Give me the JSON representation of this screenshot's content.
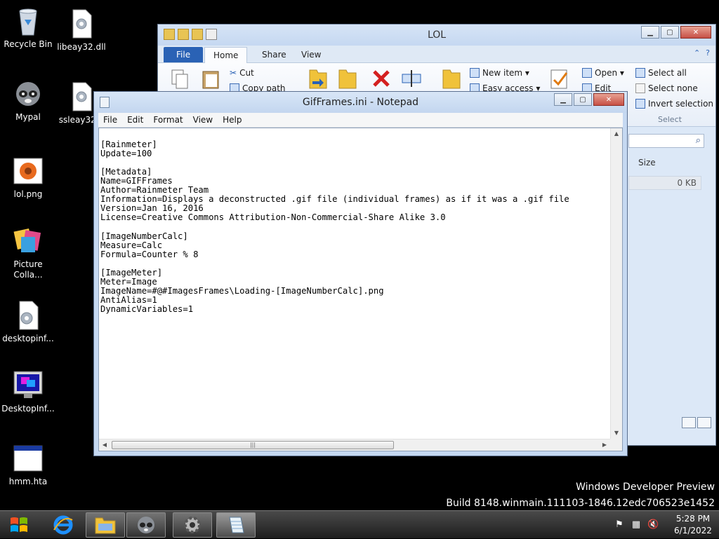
{
  "desktop": {
    "icons": [
      {
        "label": "Recycle Bin"
      },
      {
        "label": "libeay32.dll"
      },
      {
        "label": "Mypal"
      },
      {
        "label": "ssleay32..."
      },
      {
        "label": "lol.png"
      },
      {
        "label": "Picture Colla..."
      },
      {
        "label": "desktopinf..."
      },
      {
        "label": "DesktopInf..."
      },
      {
        "label": "hmm.hta"
      }
    ]
  },
  "explorer": {
    "title": "LOL",
    "tabs": [
      "File",
      "Home",
      "Share",
      "View"
    ],
    "ribbon": {
      "cut": "Cut",
      "copy_path": "Copy path",
      "new_item": "New item ▾",
      "easy_access": "Easy access ▾",
      "open": "Open ▾",
      "edit": "Edit",
      "select_all": "Select all",
      "select_none": "Select none",
      "invert_selection": "Invert selection",
      "select_group": "Select"
    },
    "column_size": "Size",
    "file_size": "0 KB"
  },
  "notepad": {
    "title": "GifFrames.ini - Notepad",
    "menu": [
      "File",
      "Edit",
      "Format",
      "View",
      "Help"
    ],
    "content": "\n[Rainmeter]\nUpdate=100\n\n[Metadata]\nName=GIFFrames\nAuthor=Rainmeter Team\nInformation=Displays a deconstructed .gif file (individual frames) as if it was a .gif file\nVersion=Jan 16, 2016\nLicense=Creative Commons Attribution-Non-Commercial-Share Alike 3.0\n\n[ImageNumberCalc]\nMeasure=Calc\nFormula=Counter % 8\n\n[ImageMeter]\nMeter=Image\nImageName=#@#ImagesFrames\\Loading-[ImageNumberCalc].png\nAntiAlias=1\nDynamicVariables=1"
  },
  "watermark": {
    "line1": "Windows Developer Preview",
    "line2": "Build 8148.winmain.111103-1846.12edc706523e1452"
  },
  "taskbar": {
    "time": "5:28 PM",
    "date": "6/1/2022"
  },
  "colors": {
    "accent": "#2a62b5",
    "titlebar": "#c5d8f1",
    "close_button": "#c75045"
  }
}
